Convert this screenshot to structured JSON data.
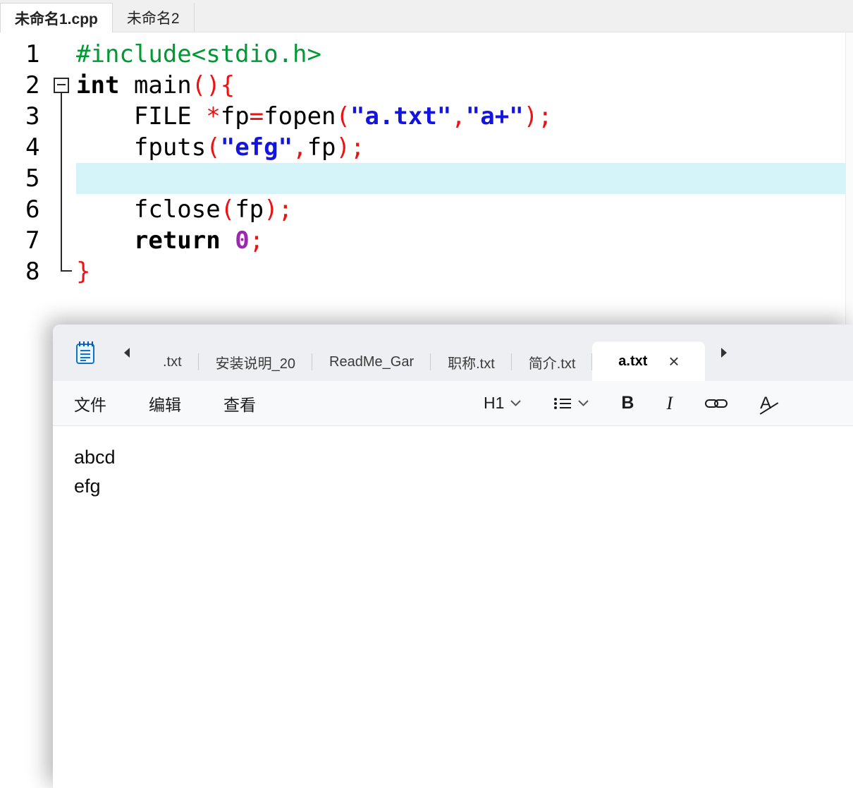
{
  "ide": {
    "tabs": [
      {
        "label": "未命名1.cpp",
        "active": true
      },
      {
        "label": "未命名2",
        "active": false
      }
    ],
    "editor": {
      "colors": {
        "preproc": "#009933",
        "string": "#1414e0",
        "symbol": "#ee1111",
        "number": "#9C27B0",
        "highlight_line_bg": "#d4f4fa"
      },
      "lines": [
        {
          "num": "1",
          "fold": "none",
          "hl": false,
          "segs": [
            [
              "preproc",
              "#include<stdio.h>"
            ]
          ]
        },
        {
          "num": "2",
          "fold": "start",
          "hl": false,
          "segs": [
            [
              "kw",
              "int"
            ],
            [
              "plain",
              " main"
            ],
            [
              "sym",
              "(){"
            ]
          ]
        },
        {
          "num": "3",
          "fold": "mid",
          "hl": false,
          "segs": [
            [
              "plain",
              "    FILE "
            ],
            [
              "sym",
              "*"
            ],
            [
              "plain",
              "fp"
            ],
            [
              "sym",
              "="
            ],
            [
              "plain",
              "fopen"
            ],
            [
              "sym",
              "("
            ],
            [
              "str",
              "\"a.txt\""
            ],
            [
              "sym",
              ","
            ],
            [
              "str",
              "\"a+\""
            ],
            [
              "sym",
              ");"
            ]
          ]
        },
        {
          "num": "4",
          "fold": "mid",
          "hl": false,
          "segs": [
            [
              "plain",
              "    fputs"
            ],
            [
              "sym",
              "("
            ],
            [
              "str",
              "\"efg\""
            ],
            [
              "sym",
              ","
            ],
            [
              "plain",
              "fp"
            ],
            [
              "sym",
              ");"
            ]
          ]
        },
        {
          "num": "5",
          "fold": "mid",
          "hl": true,
          "segs": []
        },
        {
          "num": "6",
          "fold": "mid",
          "hl": false,
          "segs": [
            [
              "plain",
              "    fclose"
            ],
            [
              "sym",
              "("
            ],
            [
              "plain",
              "fp"
            ],
            [
              "sym",
              ");"
            ]
          ]
        },
        {
          "num": "7",
          "fold": "mid",
          "hl": false,
          "segs": [
            [
              "plain",
              "    "
            ],
            [
              "kw",
              "return"
            ],
            [
              "plain",
              " "
            ],
            [
              "num",
              "0"
            ],
            [
              "sym",
              ";"
            ]
          ]
        },
        {
          "num": "8",
          "fold": "end",
          "hl": false,
          "segs": [
            [
              "sym",
              "}"
            ]
          ]
        }
      ]
    }
  },
  "notepad": {
    "tabs": {
      "items": [
        {
          "label": ".txt",
          "active": false
        },
        {
          "label": "安装说明_20",
          "active": false
        },
        {
          "label": "ReadMe_Gar",
          "active": false
        },
        {
          "label": "职称.txt",
          "active": false
        },
        {
          "label": "简介.txt",
          "active": false
        },
        {
          "label": "a.txt",
          "active": true,
          "close_icon": "×"
        }
      ]
    },
    "menus": [
      {
        "label": "文件"
      },
      {
        "label": "编辑"
      },
      {
        "label": "查看"
      }
    ],
    "toolbar": {
      "heading_label": "H1",
      "bold_label": "B",
      "italic_label": "I",
      "clear_format_label": "A"
    },
    "content_lines": [
      "abcd",
      "efg"
    ]
  }
}
